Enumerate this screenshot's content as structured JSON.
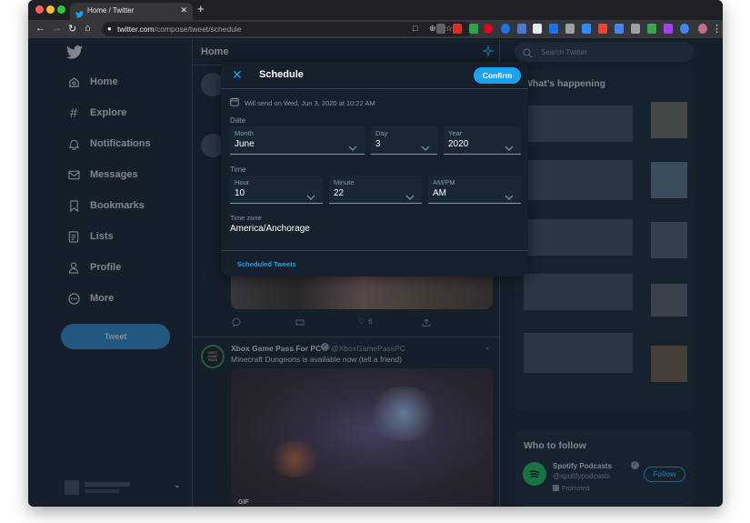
{
  "browser": {
    "tab_title": "Home / Twitter",
    "tab_close": "✕",
    "new_tab": "+",
    "url_host": "twitter.com",
    "url_path": "/compose/tweet/schedule"
  },
  "nav": {
    "items": [
      {
        "label": "Home",
        "icon": "home-icon"
      },
      {
        "label": "Explore",
        "icon": "hashtag-icon"
      },
      {
        "label": "Notifications",
        "icon": "bell-icon"
      },
      {
        "label": "Messages",
        "icon": "envelope-icon"
      },
      {
        "label": "Bookmarks",
        "icon": "bookmark-icon"
      },
      {
        "label": "Lists",
        "icon": "list-icon"
      },
      {
        "label": "Profile",
        "icon": "person-icon"
      },
      {
        "label": "More",
        "icon": "more-icon"
      }
    ],
    "tweet_button": "Tweet"
  },
  "feed": {
    "title": "Home",
    "likes_count": "6",
    "xbox": {
      "avatar_text": "XBOX GAME PASS",
      "name": "Xbox Game Pass For PC",
      "handle": "@XboxGamePassPC",
      "text": "Minecraft Dungeons is available now (tell a friend)",
      "media_tag": "GIF"
    }
  },
  "right": {
    "search_placeholder": "Search Twitter",
    "trending_title": "What’s happening",
    "who_to_follow_title": "Who to follow",
    "follow": {
      "name": "Spotify Podcasts",
      "handle": "@spotifypodcasts",
      "promoted": "Promoted",
      "button": "Follow"
    }
  },
  "modal": {
    "title": "Schedule",
    "confirm": "Confirm",
    "send_info": "Will send on Wed, Jun 3, 2020 at 10:22 AM",
    "date_section": "Date",
    "time_section": "Time",
    "fields": {
      "month": {
        "label": "Month",
        "value": "June"
      },
      "day": {
        "label": "Day",
        "value": "3"
      },
      "year": {
        "label": "Year",
        "value": "2020"
      },
      "hour": {
        "label": "Hour",
        "value": "10"
      },
      "minute": {
        "label": "Minute",
        "value": "22"
      },
      "ampm": {
        "label": "AM/PM",
        "value": "AM"
      }
    },
    "timezone_label": "Time zone",
    "timezone_value": "America/Anchorage",
    "scheduled_link": "Scheduled Tweets"
  },
  "colors": {
    "background": "#15202b",
    "accent": "#1da1f2",
    "text": "#d9d9d9",
    "secondary_text": "#8899a6"
  }
}
